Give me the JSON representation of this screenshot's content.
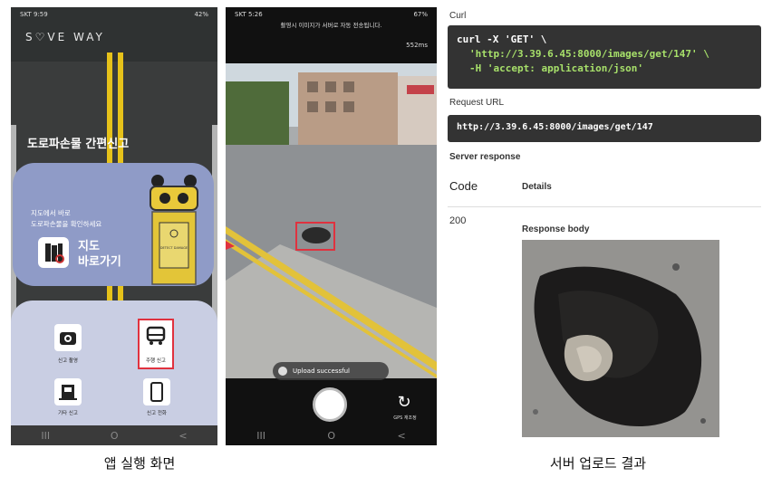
{
  "phone1": {
    "status_time": "SKT 9:59",
    "status_right": "42%",
    "app_title": "S♡VE WAY",
    "headline": "도로파손물 간편신고",
    "card_text_1": "지도에서 바로",
    "card_text_2": "도로파손물을 확인하세요",
    "map_btn_1": "지도",
    "map_btn_2": "바로가기",
    "robot_sign": "DETECT DAMAGE",
    "menu": [
      {
        "label": "신고 촬영",
        "icon": "camera-icon"
      },
      {
        "label": "주행 신고",
        "icon": "car-icon"
      },
      {
        "label": "기타 신고",
        "icon": "building-icon"
      },
      {
        "label": "신고 전화",
        "icon": "phone-icon"
      }
    ],
    "nav": [
      "III",
      "O",
      "<"
    ]
  },
  "phone2": {
    "status_time": "SKT 5:26",
    "status_right": "67%",
    "notice": "촬영시 이미지가 서버로 자동 전송됩니다.",
    "latency": "552ms",
    "toast": "Upload successful",
    "gps_label": "GPS 재조정",
    "nav": [
      "III",
      "O",
      "<"
    ]
  },
  "server": {
    "curl_label": "Curl",
    "curl_line1": "curl -X 'GET' \\",
    "curl_line2": "'http://3.39.6.45:8000/images/get/147' \\",
    "curl_line3": "-H 'accept: application/json'",
    "request_url_label": "Request URL",
    "request_url": "http://3.39.6.45:8000/images/get/147",
    "server_response_label": "Server response",
    "code_header": "Code",
    "details_header": "Details",
    "code": "200",
    "response_body_label": "Response body"
  },
  "captions": {
    "left": "앱 실행 화면",
    "right": "서버 업로드 결과"
  },
  "colors": {
    "yellow": "#e6c21a",
    "card": "#8f9bc7",
    "menu_bg": "#c9cee3",
    "highlight": "#e0323f"
  }
}
